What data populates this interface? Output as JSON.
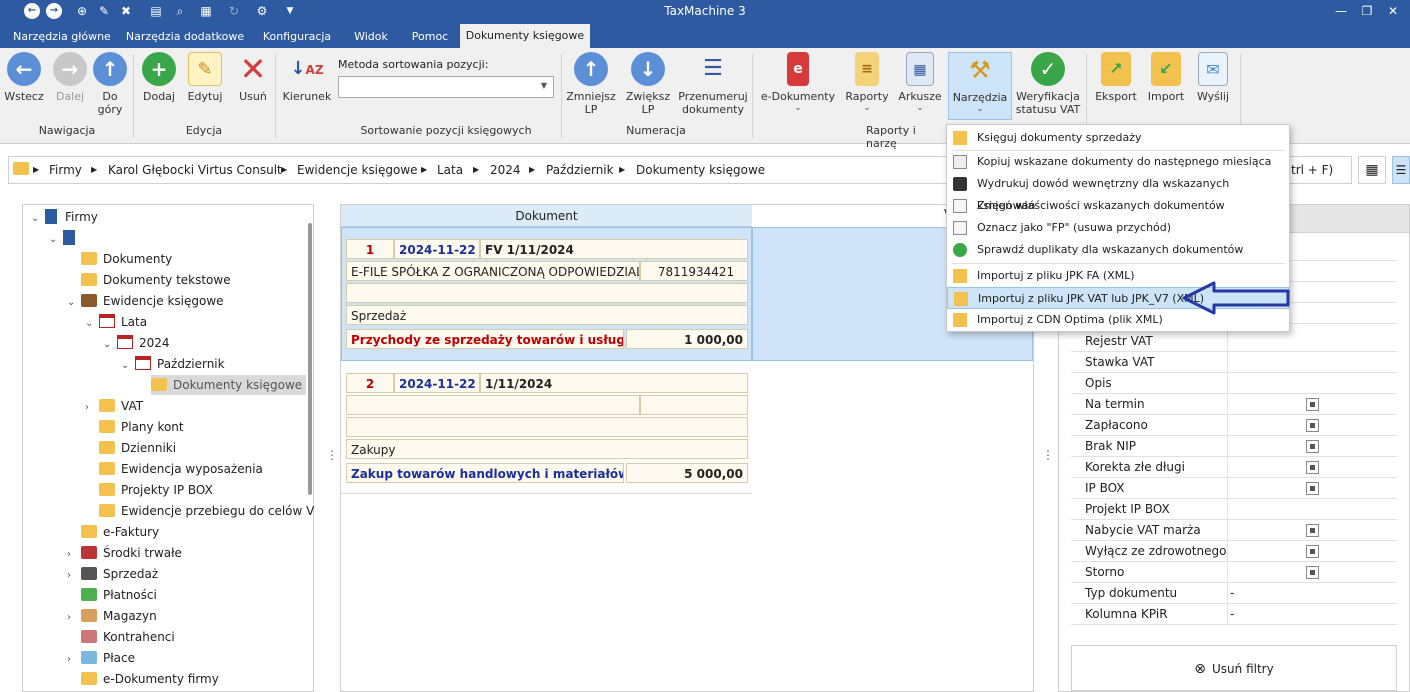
{
  "app": {
    "title": "TaxMachine 3"
  },
  "tabs": [
    "Narzędzia główne",
    "Narzędzia dodatkowe",
    "Konfiguracja",
    "Widok",
    "Pomoc",
    "Dokumenty księgowe"
  ],
  "ribbon": {
    "nav": {
      "back": "Wstecz",
      "next": "Dalej",
      "up_line1": "Do",
      "up_line2": "góry",
      "group": "Nawigacja"
    },
    "edit": {
      "add": "Dodaj",
      "edit": "Edytuj",
      "delete": "Usuń",
      "group": "Edycja"
    },
    "sort": {
      "direction": "Kierunek",
      "method_label": "Metoda sortowania pozycji:",
      "group": "Sortowanie pozycji księgowych"
    },
    "numbering": {
      "decrease_l1": "Zmniejsz",
      "decrease_l2": "LP",
      "increase_l1": "Zwiększ",
      "increase_l2": "LP",
      "renumber_l1": "Przenumeruj",
      "renumber_l2": "dokumenty",
      "group": "Numeracja"
    },
    "edocs": "e-Dokumenty",
    "reports": "Raporty",
    "sheets": "Arkusze",
    "tools": "Narzędzia",
    "vat_l1": "Weryfikacja",
    "vat_l2": "statusu VAT",
    "reports_group": "Raporty i narzę",
    "export": "Eksport",
    "import": "Import",
    "send": "Wyślij"
  },
  "breadcrumb": [
    "Firmy",
    "Karol Głębocki Virtus Consult",
    "Ewidencje księgowe",
    "Lata",
    "2024",
    "Październik",
    "Dokumenty księgowe"
  ],
  "search_hint": "trl + F)",
  "tree": {
    "root": "Firmy",
    "items": [
      "Dokumenty",
      "Dokumenty tekstowe",
      "Ewidencje księgowe",
      "Lata",
      "2024",
      "Październik",
      "Dokumenty księgowe",
      "VAT",
      "Plany kont",
      "Dzienniki",
      "Ewidencja wyposażenia",
      "Projekty IP BOX",
      "Ewidencje przebiegu do celów V",
      "e-Faktury",
      "Środki trwałe",
      "Sprzedaż",
      "Płatności",
      "Magazyn",
      "Kontrahenci",
      "Płace",
      "e-Dokumenty firmy"
    ]
  },
  "documents": {
    "header": "Dokument",
    "header2": "V",
    "rows": [
      {
        "lp": "1",
        "date": "2024-11-22",
        "number": "FV 1/11/2024",
        "contractor": "E-FILE SPÓŁKA Z OGRANICZONĄ ODPOWIEDZIALNOŚCIĄ",
        "nip": "7811934421",
        "type": "Sprzedaż",
        "column": "Przychody ze sprzedaży towarów i usług",
        "amount": "1 000,00"
      },
      {
        "lp": "2",
        "date": "2024-11-22",
        "number": "1/11/2024",
        "contractor": "",
        "nip": "",
        "type": "Zakupy",
        "column": "Zakup towarów handlowych i materiałów",
        "amount": "5 000,00"
      }
    ]
  },
  "properties": [
    {
      "label": "Rejestr VAT",
      "value": ""
    },
    {
      "label": "Stawka VAT",
      "value": ""
    },
    {
      "label": "Opis",
      "value": ""
    },
    {
      "label": "Na termin",
      "value": "check"
    },
    {
      "label": "Zapłacono",
      "value": "check"
    },
    {
      "label": "Brak NIP",
      "value": "check"
    },
    {
      "label": "Korekta złe długi",
      "value": "check"
    },
    {
      "label": "IP BOX",
      "value": "check"
    },
    {
      "label": "Projekt IP BOX",
      "value": ""
    },
    {
      "label": "Nabycie VAT marża",
      "value": "check"
    },
    {
      "label": "Wyłącz ze zdrowotnego",
      "value": "check"
    },
    {
      "label": "Storno",
      "value": "check"
    },
    {
      "label": "Typ dokumentu",
      "value": "-"
    },
    {
      "label": "Kolumna KPiR",
      "value": "-"
    }
  ],
  "clear_filters": "Usuń filtry",
  "menu": {
    "items": [
      "Księguj dokumenty sprzedaży",
      "Kopiuj wskazane dokumenty do następnego miesiąca",
      "Wydrukuj dowód wewnętrzny dla wskazanych księgowań",
      "Zmień właściwości wskazanych dokumentów",
      "Oznacz jako \"FP\" (usuwa przychód)",
      "Sprawdź duplikaty dla wskazanych dokumentów",
      "Importuj z pliku JPK FA (XML)",
      "Importuj z pliku JPK VAT lub JPK_V7 (XML)",
      "Importuj z CDN Optima (plik XML)"
    ],
    "highlighted": 7
  },
  "colors": {
    "accent": "#2d5aa0",
    "red_text": "#c00000",
    "blue_text": "#1a2fa0",
    "arrow": "#2438a8"
  }
}
